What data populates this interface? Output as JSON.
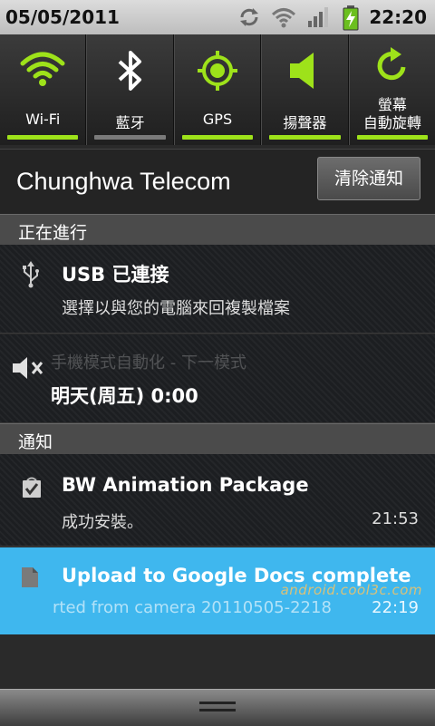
{
  "status_bar": {
    "date": "05/05/2011",
    "time": "22:20",
    "icons": [
      "sync-icon",
      "wifi-signal-icon",
      "cell-signal-icon",
      "battery-charging-icon"
    ]
  },
  "toggles": [
    {
      "label": "Wi-Fi",
      "icon": "wifi-icon",
      "active": true
    },
    {
      "label": "藍牙",
      "icon": "bluetooth-icon",
      "active": false
    },
    {
      "label": "GPS",
      "icon": "gps-icon",
      "active": true
    },
    {
      "label": "揚聲器",
      "icon": "speaker-icon",
      "active": true
    },
    {
      "label_line1": "螢幕",
      "label_line2": "自動旋轉",
      "icon": "rotate-icon",
      "active": true
    }
  ],
  "carrier": {
    "name": "Chunghwa Telecom",
    "clear_label": "清除通知"
  },
  "sections": {
    "ongoing": "正在進行",
    "notifications": "通知"
  },
  "ongoing_items": [
    {
      "title": "USB 已連接",
      "subtitle": "選擇以與您的電腦來回複製檔案",
      "icon": "usb-icon"
    },
    {
      "title": "手機模式自動化 - 下一模式",
      "subtitle": "明天(周五) 0:00",
      "icon": "mute-icon"
    }
  ],
  "notification_items": [
    {
      "title": "BW Animation Package",
      "subtitle": "成功安裝。",
      "time": "21:53",
      "icon": "package-icon"
    },
    {
      "title": "Upload to Google Docs complete",
      "subtitle": "rted from camera 20110505-2218",
      "time": "22:19",
      "icon": "document-icon"
    }
  ],
  "watermark": "android.cool3c.com",
  "colors": {
    "accent_green": "#9ee21a",
    "inactive_bar": "#7a7a7a",
    "highlight_blue": "#3fb7ee"
  }
}
